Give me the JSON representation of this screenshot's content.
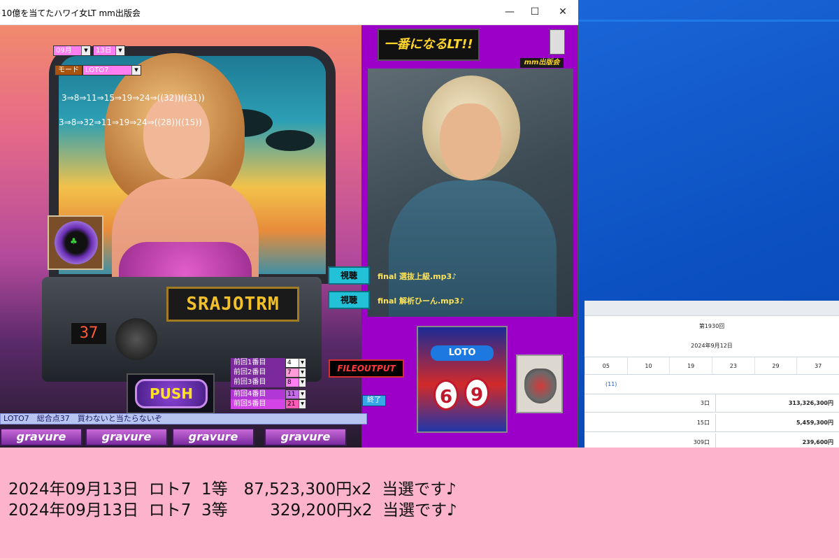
{
  "window": {
    "title": "10億を当てたハワイ女LT  mm出版会",
    "controls": {
      "minimize": "—",
      "maximize": "☐",
      "close": "✕"
    }
  },
  "controls": {
    "month": "09月",
    "day": "13日",
    "mode_label": "モード",
    "mode_value": "LOTO7"
  },
  "sequences": [
    "3⇒8⇒11⇒15⇒19⇒24⇒((32))((31))",
    "3⇒8⇒32⇒11⇒19⇒24⇒((28))((15))"
  ],
  "machine": {
    "marquee": "SRAJOTRM",
    "digits": "37"
  },
  "push_label": "PUSH",
  "previous": [
    {
      "label": "前回1番目",
      "value": "4"
    },
    {
      "label": "前回2番目",
      "value": "7"
    },
    {
      "label": "前回3番目",
      "value": "8"
    },
    {
      "label": "前回4番目",
      "value": "11"
    },
    {
      "label": "前回5番目",
      "value": "21"
    }
  ],
  "status_text": "LOTO7　総合点37　買わないと当たらないぞ",
  "gravure_tiles": [
    "gravure",
    "gravure",
    "gravure",
    "gravure"
  ],
  "logo_text": "一番になるLT!!",
  "mm_label": "mm出版会",
  "play_buttons": [
    {
      "label": "視聴",
      "track": "final 選抜上級.mp3♪"
    },
    {
      "label": "視聴",
      "track": "final 解析ひーん.mp3♪"
    }
  ],
  "fileoutput_label": "FILEOUTPUT",
  "end_label": "終了",
  "loto_card": {
    "tag": "LOTO",
    "left": "6",
    "right": "9"
  },
  "sheet": {
    "round": "第1930回",
    "date": "2024年9月12日",
    "numbers": [
      "05",
      "10",
      "19",
      "23",
      "29",
      "37"
    ],
    "bonus": "(11)",
    "prizes": [
      {
        "units": "3口",
        "amount": "313,326,300円"
      },
      {
        "units": "15口",
        "amount": "5,459,300円"
      },
      {
        "units": "309口",
        "amount": "239,600円"
      }
    ]
  },
  "banner": [
    "2024年09月13日  ロト7  1等　87,523,300円x2  当選です♪",
    "2024年09月13日  ロト7  3等　　  329,200円x2  当選です♪"
  ],
  "colors": {
    "window_bg": "#9c00c8",
    "banner_bg": "#fdb3cc",
    "desktop": "#0b4fc0"
  }
}
